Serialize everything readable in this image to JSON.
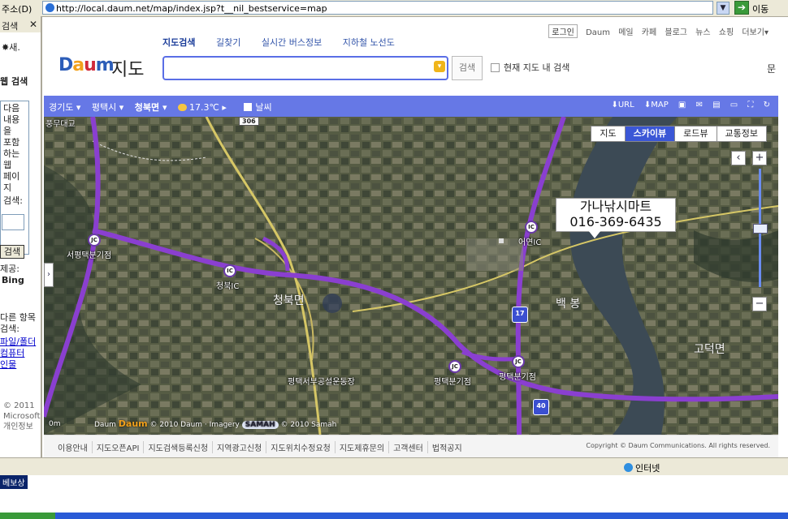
{
  "address_bar": {
    "label": "주소(D)",
    "url": "http://local.daum.net/map/index.jsp?t__nil_bestservice=map",
    "go_label": "이동"
  },
  "left_pane": {
    "title": "검색",
    "new_label": "새.",
    "search_heading": "웹 검색",
    "description": [
      "다음",
      "내용",
      "을",
      "포함",
      "하는",
      "웹",
      "페이",
      "지",
      "검색:"
    ],
    "search_button": "검색",
    "provider_label": "제공:",
    "provider_name": "Bing",
    "other_search": "다른 항목 검색:",
    "links": [
      "파일/폴더",
      "컴퓨터",
      "인물"
    ],
    "copyright": "© 2011 Microsoft 개인정보"
  },
  "header": {
    "login": "로그인",
    "util_links": [
      "Daum",
      "메일",
      "카페",
      "블로그",
      "뉴스",
      "쇼핑",
      "더보기"
    ],
    "tabs": [
      "지도검색",
      "길찾기",
      "실시간 버스정보",
      "지하철 노선도"
    ],
    "logo_daum": [
      "D",
      "a",
      "u",
      "m"
    ],
    "logo_service": "지도",
    "search_value": "",
    "search_button": "검색",
    "in_map_label": "현재 지도 내 검색",
    "side_char": "문"
  },
  "toolbar": {
    "crumbs": [
      "경기도 ▾",
      "평택시 ▾",
      "청북면 ▾"
    ],
    "weather": "17.3℃ ▸",
    "weather_toggle": "날씨",
    "tools": [
      "⬇URL",
      "⬇MAP",
      "▣",
      "✉",
      "▤",
      "▭",
      "⛶",
      "↻"
    ]
  },
  "map": {
    "types": [
      "지도",
      "스카이뷰",
      "로드뷰",
      "교통정보"
    ],
    "active_type": "스카이뷰",
    "callout_name": "가나낚시마트",
    "callout_phone": "016-369-6435",
    "labels": {
      "bridge": "풍무대교",
      "road_306": "306",
      "jc1": "서평택분기점",
      "ic1": "청북IC",
      "town": "청북면",
      "ic2": "어연IC",
      "area1": "백 봉",
      "area2": "고덕면",
      "venue": "평택서부공설운동장",
      "jc2": "평택분기점",
      "jc3": "평택분기점",
      "shield1": "17",
      "shield2": "40",
      "jc_tag": "JC",
      "ic_tag": "IC"
    },
    "scale": "0m",
    "attribution_prefix": "Daum",
    "attribution_brand": "Daum",
    "attribution_imagery": "© 2010 Daum · Imagery",
    "attribution_samah": "SAMAH",
    "attribution_year": "© 2010 Samah"
  },
  "footer": {
    "links": [
      "이용안내",
      "지도오픈API",
      "지도검색등록신청",
      "지역광고신청",
      "지도위치수정요청",
      "지도제휴문의",
      "고객센터",
      "법적공지"
    ],
    "copyright": "Copyright © Daum Communications. All rights reserved."
  },
  "status_bar": {
    "zone": "인터넷"
  },
  "desktop": {
    "icon_label": "베보상"
  }
}
